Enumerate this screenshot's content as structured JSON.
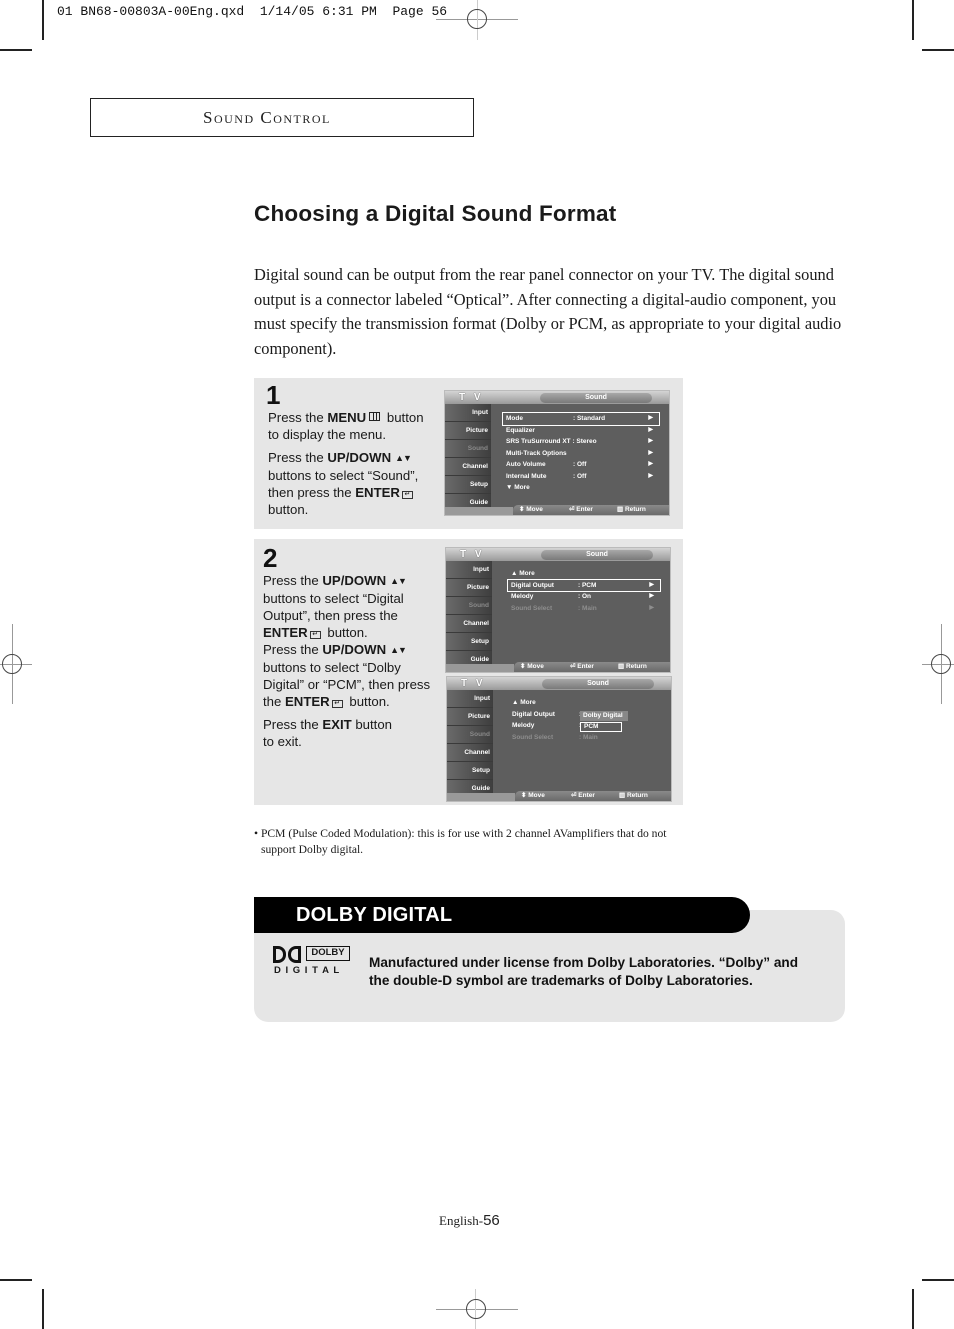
{
  "slug": "01 BN68-00803A-00Eng.qxd  1/14/05 6:31 PM  Page 56",
  "section_header": "Sound Control",
  "title": "Choosing a Digital Sound Format",
  "intro": "Digital sound can be output from the rear panel connector on your TV. The digital sound output is a connector labeled “Optical”. After connecting a digital-audio component, you must specify the transmission format (Dolby or PCM, as appropriate to your digital audio component).",
  "steps": [
    {
      "number": "1",
      "lines": [
        {
          "pre": "Press the ",
          "bold": "MENU",
          "icon": "menu-icon",
          "post": " button to display the menu."
        },
        {
          "pre": "Press the ",
          "bold": "UP/DOWN",
          "icon": "up-down-icon",
          "post": " buttons to select “Sound”, then press the ",
          "bold2": "ENTER",
          "icon2": "enter-icon",
          "post2": " button."
        }
      ]
    },
    {
      "number": "2",
      "lines": [
        {
          "pre": "Press the ",
          "bold": "UP/DOWN",
          "post": " buttons to select “Digital Output”, then press the ",
          "bold2": "ENTER",
          "post2": " button."
        },
        {
          "pre": "Press the ",
          "bold": "UP/DOWN",
          "post": " buttons to select “Dolby Digital” or “PCM”, then press the ",
          "bold2": "ENTER",
          "post2": " button."
        },
        {
          "pre": "Press the ",
          "bold": "EXIT",
          "post": " button to exit."
        }
      ]
    }
  ],
  "tv_screens": [
    {
      "label": "T V",
      "tab": "Sound",
      "side": [
        "Input",
        "Picture",
        "Sound",
        "Channel",
        "Setup",
        "Guide"
      ],
      "rows": [
        {
          "k": "Mode",
          "v": ": Standard",
          "arrow": "▶",
          "selected": true
        },
        {
          "k": "Equalizer",
          "v": "",
          "arrow": "▶"
        },
        {
          "k": "SRS TruSurround XT : Stereo",
          "v": "",
          "arrow": "▶"
        },
        {
          "k": "Multi-Track Options",
          "v": "",
          "arrow": "▶"
        },
        {
          "k": "Auto Volume",
          "v": ": Off",
          "arrow": "▶"
        },
        {
          "k": "Internal Mute",
          "v": ": Off",
          "arrow": "▶"
        },
        {
          "k": "▼ More",
          "v": "",
          "arrow": ""
        }
      ],
      "footer": {
        "move": "Move",
        "enter": "Enter",
        "return": "Return"
      }
    },
    {
      "label": "T V",
      "tab": "Sound",
      "side": [
        "Input",
        "Picture",
        "Sound",
        "Channel",
        "Setup",
        "Guide"
      ],
      "rows": [
        {
          "k": "▲ More",
          "v": "",
          "arrow": ""
        },
        {
          "k": "Digital Output",
          "v": ": PCM",
          "arrow": "▶",
          "selected": true
        },
        {
          "k": "Melody",
          "v": ": On",
          "arrow": "▶"
        },
        {
          "k": "Sound Select",
          "v": ": Main",
          "arrow": "▶",
          "dim": true
        }
      ],
      "footer": {
        "move": "Move",
        "enter": "Enter",
        "return": "Return"
      }
    },
    {
      "label": "T V",
      "tab": "Sound",
      "side": [
        "Input",
        "Picture",
        "Sound",
        "Channel",
        "Setup",
        "Guide"
      ],
      "rows": [
        {
          "k": "▲ More",
          "v": "",
          "arrow": ""
        },
        {
          "k": "Digital Output",
          "v": ":",
          "arrow": ""
        },
        {
          "k": "Melody",
          "v": ":",
          "arrow": ""
        },
        {
          "k": "Sound Select",
          "v": ": Main",
          "arrow": "",
          "dim": true
        }
      ],
      "options": [
        "Dolby Digital",
        "PCM"
      ],
      "selected_option": "PCM",
      "footer": {
        "move": "Move",
        "enter": "Enter",
        "return": "Return"
      }
    }
  ],
  "note": "• PCM (Pulse Coded Modulation): this is for use with 2 channel AVamplifiers that do not support Dolby digital.",
  "note_line1": "• PCM (Pulse Coded Modulation): this is for use with 2 channel AVamplifiers that do not",
  "note_line2": "support Dolby digital.",
  "dolby": {
    "heading": "DOLBY DIGITAL",
    "logo_word": "DOLBY",
    "logo_sub": "D I G I T A L",
    "text": "Manufactured under license from Dolby Laboratories. “Dolby” and the double-D symbol are trademarks of Dolby Laboratories."
  },
  "page_footer": {
    "prefix": "English-",
    "number": "56"
  }
}
